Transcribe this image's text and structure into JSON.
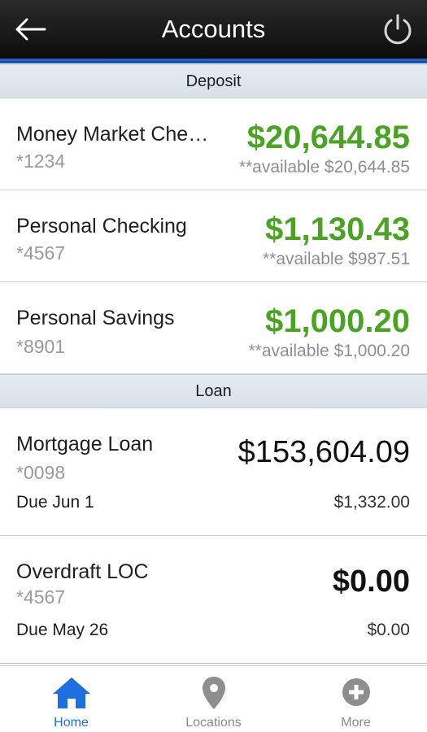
{
  "header": {
    "title": "Accounts",
    "back_icon": "arrow-left-icon",
    "power_icon": "power-icon"
  },
  "colors": {
    "header_bg": "#111111",
    "accent_blue": "#1e6fe0",
    "balance_green": "#4aa325",
    "section_bg": "#dfe6ee"
  },
  "deposit": {
    "section_label": "Deposit",
    "accounts": [
      {
        "name": "Money Market Che…",
        "number": "*1234",
        "balance": "$20,644.85",
        "available": "**available $20,644.85"
      },
      {
        "name": "Personal Checking",
        "number": "*4567",
        "balance": "$1,130.43",
        "available": "**available $987.51"
      },
      {
        "name": "Personal Savings",
        "number": "*8901",
        "balance": "$1,000.20",
        "available": "**available $1,000.20"
      }
    ]
  },
  "loan": {
    "section_label": "Loan",
    "accounts": [
      {
        "name": "Mortgage Loan",
        "number": "*0098",
        "balance": "$153,604.09",
        "due_label": "Due Jun 1",
        "due_amount": "$1,332.00"
      },
      {
        "name": "Overdraft LOC",
        "number": "*4567",
        "balance": "$0.00",
        "due_label": "Due May 26",
        "due_amount": "$0.00"
      }
    ]
  },
  "tabbar": {
    "tabs": [
      {
        "label": "Home",
        "icon": "home-icon",
        "active": true
      },
      {
        "label": "Locations",
        "icon": "location-pin-icon",
        "active": false
      },
      {
        "label": "More",
        "icon": "plus-circle-icon",
        "active": false
      }
    ]
  }
}
